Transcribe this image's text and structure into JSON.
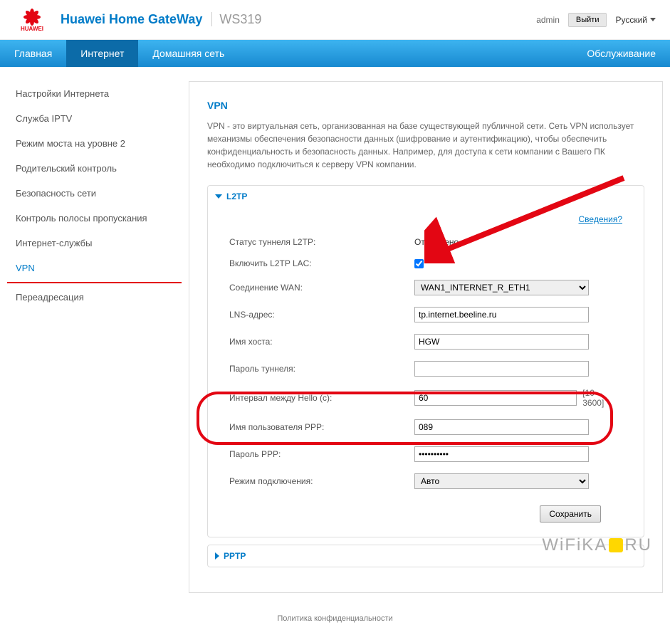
{
  "header": {
    "brand": "HUAWEI",
    "title": "Huawei Home GateWay",
    "model": "WS319",
    "admin": "admin",
    "logout": "Выйти",
    "lang": "Русский"
  },
  "nav": {
    "items": [
      "Главная",
      "Интернет",
      "Домашняя сеть"
    ],
    "right": "Обслуживание",
    "active_index": 1
  },
  "sidebar": {
    "items": [
      "Настройки Интернета",
      "Служба IPTV",
      "Режим моста на уровне 2",
      "Родительский контроль",
      "Безопасность сети",
      "Контроль полосы пропускания",
      "Интернет-службы",
      "VPN",
      "Переадресация"
    ],
    "active_index": 7
  },
  "content": {
    "title": "VPN",
    "description": "VPN - это виртуальная сеть, организованная на базе существующей публичной сети. Сеть VPN использует механизмы обеспечения безопасности данных (шифрование и аутентификацию), чтобы обеспечить конфиденциальность и безопасность данных. Например, для доступа к сети компании с Вашего ПК необходимо подключиться к серверу VPN компании."
  },
  "l2tp": {
    "panel_title": "L2TP",
    "details_link": "Сведения?",
    "status_label": "Статус туннеля L2TP:",
    "status_value": "Отключено",
    "enable_label": "Включить L2TP LAC:",
    "enable_checked": true,
    "wan_label": "Соединение WAN:",
    "wan_value": "WAN1_INTERNET_R_ETH1",
    "lns_label": "LNS-адрес:",
    "lns_value": "tp.internet.beeline.ru",
    "host_label": "Имя хоста:",
    "host_value": "HGW",
    "tunnel_pass_label": "Пароль туннеля:",
    "tunnel_pass_value": "",
    "hello_label": "Интервал между Hello (с):",
    "hello_value": "60",
    "hello_range": "[10 – 3600]",
    "ppp_user_label": "Имя пользователя PPP:",
    "ppp_user_value": "089",
    "ppp_pass_label": "Пароль PPP:",
    "ppp_pass_value": "••••••••••",
    "conn_mode_label": "Режим подключения:",
    "conn_mode_value": "Авто",
    "save": "Сохранить"
  },
  "pptp": {
    "panel_title": "PPTP"
  },
  "footer": {
    "privacy": "Политика конфиденциальности"
  },
  "watermark": {
    "text_left": "WiFiKA",
    "text_right": "RU"
  }
}
